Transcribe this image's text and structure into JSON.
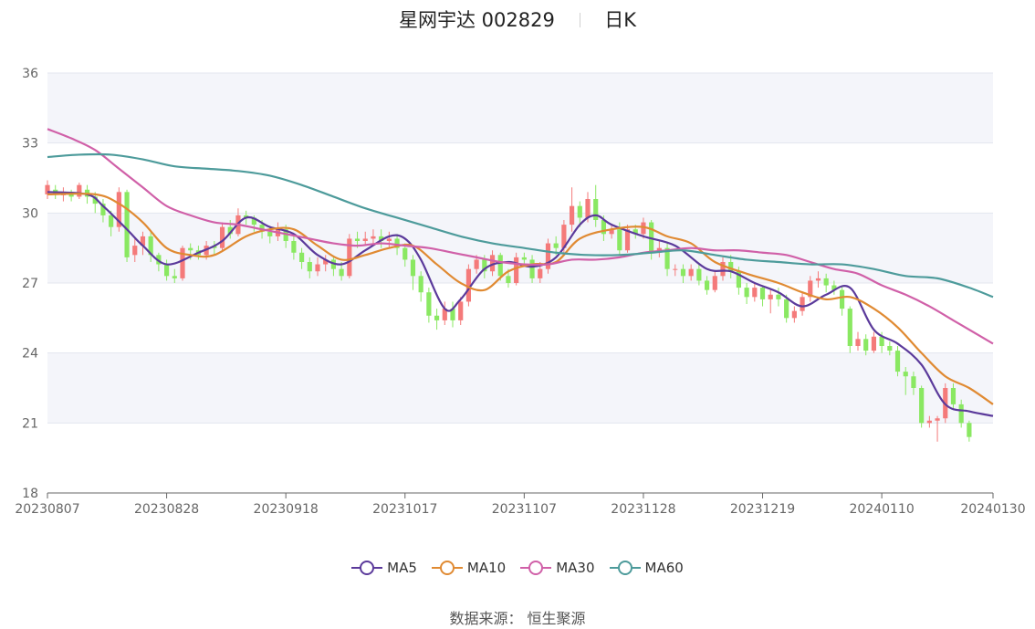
{
  "title": {
    "name": "星网宇达 002829",
    "period": "日K"
  },
  "source": "数据来源： 恒生聚源",
  "chart_data": {
    "type": "candlestick",
    "y_ticks": [
      18,
      21,
      24,
      27,
      30,
      33,
      36
    ],
    "ylim": [
      18,
      36
    ],
    "x_labels": [
      "20230807",
      "20230828",
      "20230918",
      "20231017",
      "20231107",
      "20231128",
      "20231219",
      "20240110",
      "20240130"
    ],
    "x_label_index": [
      0,
      15,
      30,
      45,
      60,
      75,
      90,
      105,
      119
    ],
    "n_days": 120,
    "colors": {
      "up": "#f47a7a",
      "down": "#8ae862",
      "grid_band": "#f4f5fa",
      "grid_line": "#e3e6ef",
      "axis": "#666666"
    },
    "series": [
      {
        "name": "MA5",
        "color": "#5b3a9b",
        "points": [
          [
            0,
            30.9
          ],
          [
            5,
            30.8
          ],
          [
            7,
            30.3
          ],
          [
            10,
            29.3
          ],
          [
            12,
            28.6
          ],
          [
            15,
            27.8
          ],
          [
            19,
            28.3
          ],
          [
            22,
            28.8
          ],
          [
            25,
            29.8
          ],
          [
            28,
            29.4
          ],
          [
            31,
            29.1
          ],
          [
            34,
            28.2
          ],
          [
            37,
            27.8
          ],
          [
            40,
            28.4
          ],
          [
            43,
            29.0
          ],
          [
            45,
            28.9
          ],
          [
            47,
            28.0
          ],
          [
            50,
            25.9
          ],
          [
            52,
            26.3
          ],
          [
            55,
            27.6
          ],
          [
            58,
            27.9
          ],
          [
            61,
            27.7
          ],
          [
            64,
            28.1
          ],
          [
            67,
            29.5
          ],
          [
            69,
            29.9
          ],
          [
            71,
            29.5
          ],
          [
            75,
            29.0
          ],
          [
            79,
            28.6
          ],
          [
            83,
            27.6
          ],
          [
            86,
            27.5
          ],
          [
            89,
            27.0
          ],
          [
            92,
            26.6
          ],
          [
            95,
            26.0
          ],
          [
            98,
            26.5
          ],
          [
            101,
            26.8
          ],
          [
            104,
            25.0
          ],
          [
            107,
            24.4
          ],
          [
            110,
            23.5
          ],
          [
            113,
            21.8
          ],
          [
            116,
            21.5
          ],
          [
            119,
            21.3
          ]
        ]
      },
      {
        "name": "MA10",
        "color": "#e08a32",
        "points": [
          [
            0,
            30.8
          ],
          [
            6,
            30.8
          ],
          [
            9,
            30.4
          ],
          [
            12,
            29.6
          ],
          [
            15,
            28.5
          ],
          [
            18,
            28.2
          ],
          [
            21,
            28.2
          ],
          [
            25,
            29.0
          ],
          [
            28,
            29.3
          ],
          [
            31,
            29.3
          ],
          [
            34,
            28.6
          ],
          [
            37,
            28.0
          ],
          [
            40,
            28.2
          ],
          [
            43,
            28.5
          ],
          [
            46,
            28.6
          ],
          [
            49,
            27.8
          ],
          [
            52,
            27.0
          ],
          [
            55,
            26.7
          ],
          [
            58,
            27.5
          ],
          [
            61,
            27.8
          ],
          [
            64,
            27.9
          ],
          [
            67,
            28.9
          ],
          [
            71,
            29.3
          ],
          [
            75,
            29.4
          ],
          [
            78,
            29.0
          ],
          [
            81,
            28.7
          ],
          [
            84,
            27.9
          ],
          [
            88,
            27.4
          ],
          [
            92,
            27.0
          ],
          [
            95,
            26.6
          ],
          [
            98,
            26.3
          ],
          [
            101,
            26.4
          ],
          [
            104,
            25.9
          ],
          [
            107,
            25.1
          ],
          [
            110,
            24.0
          ],
          [
            113,
            23.0
          ],
          [
            116,
            22.5
          ],
          [
            119,
            21.8
          ]
        ]
      },
      {
        "name": "MA30",
        "color": "#d060a8",
        "points": [
          [
            0,
            33.6
          ],
          [
            3,
            33.2
          ],
          [
            6,
            32.7
          ],
          [
            9,
            31.9
          ],
          [
            12,
            31.1
          ],
          [
            15,
            30.3
          ],
          [
            18,
            29.9
          ],
          [
            21,
            29.6
          ],
          [
            24,
            29.5
          ],
          [
            27,
            29.3
          ],
          [
            30,
            29.1
          ],
          [
            33,
            28.9
          ],
          [
            36,
            28.7
          ],
          [
            39,
            28.6
          ],
          [
            42,
            28.7
          ],
          [
            45,
            28.6
          ],
          [
            48,
            28.5
          ],
          [
            51,
            28.3
          ],
          [
            54,
            28.1
          ],
          [
            57,
            27.9
          ],
          [
            60,
            27.8
          ],
          [
            63,
            27.8
          ],
          [
            66,
            28.0
          ],
          [
            69,
            28.0
          ],
          [
            72,
            28.1
          ],
          [
            75,
            28.3
          ],
          [
            78,
            28.4
          ],
          [
            81,
            28.5
          ],
          [
            84,
            28.4
          ],
          [
            87,
            28.4
          ],
          [
            90,
            28.3
          ],
          [
            93,
            28.2
          ],
          [
            96,
            27.9
          ],
          [
            99,
            27.6
          ],
          [
            102,
            27.4
          ],
          [
            105,
            26.9
          ],
          [
            108,
            26.5
          ],
          [
            111,
            26.0
          ],
          [
            114,
            25.4
          ],
          [
            117,
            24.8
          ],
          [
            119,
            24.4
          ]
        ]
      },
      {
        "name": "MA60",
        "color": "#4d9b9b",
        "points": [
          [
            0,
            32.4
          ],
          [
            4,
            32.5
          ],
          [
            8,
            32.5
          ],
          [
            12,
            32.3
          ],
          [
            16,
            32.0
          ],
          [
            20,
            31.9
          ],
          [
            24,
            31.8
          ],
          [
            28,
            31.6
          ],
          [
            32,
            31.2
          ],
          [
            36,
            30.7
          ],
          [
            40,
            30.2
          ],
          [
            44,
            29.8
          ],
          [
            48,
            29.4
          ],
          [
            52,
            29.0
          ],
          [
            56,
            28.7
          ],
          [
            60,
            28.5
          ],
          [
            64,
            28.3
          ],
          [
            68,
            28.2
          ],
          [
            72,
            28.2
          ],
          [
            76,
            28.3
          ],
          [
            80,
            28.4
          ],
          [
            84,
            28.2
          ],
          [
            88,
            28.0
          ],
          [
            92,
            27.9
          ],
          [
            96,
            27.8
          ],
          [
            100,
            27.8
          ],
          [
            104,
            27.6
          ],
          [
            108,
            27.3
          ],
          [
            112,
            27.2
          ],
          [
            116,
            26.8
          ],
          [
            119,
            26.4
          ]
        ]
      }
    ],
    "candles_ohlc": [
      [
        30.8,
        31.2,
        30.6,
        31.4
      ],
      [
        31.0,
        30.8,
        30.6,
        31.2
      ],
      [
        30.8,
        30.8,
        30.5,
        31.1
      ],
      [
        30.8,
        30.7,
        30.5,
        31.0
      ],
      [
        30.7,
        31.2,
        30.6,
        31.3
      ],
      [
        31.0,
        30.7,
        30.4,
        31.2
      ],
      [
        30.7,
        30.4,
        30.0,
        30.9
      ],
      [
        30.4,
        29.9,
        29.6,
        30.6
      ],
      [
        29.9,
        29.4,
        29.0,
        30.1
      ],
      [
        29.4,
        30.9,
        29.2,
        31.1
      ],
      [
        30.9,
        28.1,
        27.9,
        31.0
      ],
      [
        28.2,
        28.6,
        27.9,
        28.9
      ],
      [
        28.6,
        29.0,
        28.2,
        29.2
      ],
      [
        29.0,
        28.2,
        27.9,
        29.2
      ],
      [
        28.2,
        27.8,
        27.5,
        28.3
      ],
      [
        27.8,
        27.3,
        27.1,
        28.0
      ],
      [
        27.3,
        27.2,
        27.0,
        27.6
      ],
      [
        27.2,
        28.5,
        27.1,
        28.6
      ],
      [
        28.5,
        28.4,
        28.0,
        28.7
      ],
      [
        28.4,
        28.2,
        28.0,
        28.6
      ],
      [
        28.2,
        28.6,
        28.0,
        28.8
      ],
      [
        28.6,
        28.5,
        28.2,
        28.8
      ],
      [
        28.5,
        29.4,
        28.4,
        29.6
      ],
      [
        29.4,
        29.1,
        28.9,
        29.7
      ],
      [
        29.1,
        29.9,
        29.0,
        30.2
      ],
      [
        29.9,
        29.8,
        29.5,
        30.1
      ],
      [
        29.8,
        29.5,
        29.2,
        29.9
      ],
      [
        29.5,
        29.2,
        28.9,
        29.7
      ],
      [
        29.2,
        29.0,
        28.7,
        29.4
      ],
      [
        29.0,
        29.3,
        28.8,
        29.6
      ],
      [
        29.3,
        28.8,
        28.5,
        29.5
      ],
      [
        28.8,
        28.3,
        28.0,
        29.0
      ],
      [
        28.3,
        27.9,
        27.6,
        28.5
      ],
      [
        27.9,
        27.5,
        27.2,
        28.1
      ],
      [
        27.5,
        27.8,
        27.3,
        28.1
      ],
      [
        27.8,
        28.0,
        27.5,
        28.2
      ],
      [
        28.0,
        27.6,
        27.3,
        28.1
      ],
      [
        27.6,
        27.3,
        27.1,
        27.9
      ],
      [
        27.3,
        28.9,
        27.2,
        29.1
      ],
      [
        28.9,
        28.8,
        28.5,
        29.2
      ],
      [
        28.8,
        28.9,
        28.6,
        29.2
      ],
      [
        28.9,
        29.0,
        28.6,
        29.3
      ],
      [
        29.0,
        28.8,
        28.5,
        29.3
      ],
      [
        28.8,
        28.9,
        28.5,
        29.2
      ],
      [
        28.9,
        28.5,
        28.2,
        29.1
      ],
      [
        28.5,
        28.0,
        27.7,
        28.7
      ],
      [
        28.0,
        27.3,
        26.7,
        28.2
      ],
      [
        27.3,
        26.6,
        26.2,
        27.5
      ],
      [
        26.6,
        25.6,
        25.3,
        26.8
      ],
      [
        25.6,
        25.4,
        25.0,
        25.9
      ],
      [
        25.4,
        25.9,
        25.2,
        26.2
      ],
      [
        25.9,
        25.4,
        25.1,
        26.2
      ],
      [
        25.4,
        26.2,
        25.2,
        26.4
      ],
      [
        26.2,
        27.6,
        26.0,
        27.8
      ],
      [
        27.6,
        28.0,
        27.4,
        28.2
      ],
      [
        28.0,
        27.5,
        27.2,
        28.2
      ],
      [
        27.5,
        28.2,
        27.3,
        28.4
      ],
      [
        28.2,
        27.3,
        27.1,
        28.3
      ],
      [
        27.3,
        27.0,
        26.8,
        27.6
      ],
      [
        27.0,
        28.1,
        26.9,
        28.3
      ],
      [
        28.1,
        28.0,
        27.7,
        28.3
      ],
      [
        28.0,
        27.2,
        27.0,
        28.2
      ],
      [
        27.2,
        27.6,
        27.0,
        27.9
      ],
      [
        27.6,
        28.7,
        27.4,
        28.9
      ],
      [
        28.7,
        28.5,
        28.2,
        29.0
      ],
      [
        28.5,
        29.5,
        28.3,
        29.7
      ],
      [
        29.5,
        30.3,
        29.2,
        31.1
      ],
      [
        30.3,
        29.8,
        29.4,
        30.5
      ],
      [
        29.8,
        30.6,
        29.6,
        30.9
      ],
      [
        30.6,
        29.7,
        29.4,
        31.2
      ],
      [
        29.7,
        29.1,
        28.8,
        29.9
      ],
      [
        29.1,
        29.3,
        28.9,
        29.5
      ],
      [
        29.3,
        28.4,
        28.2,
        29.6
      ],
      [
        28.4,
        29.3,
        28.3,
        29.5
      ],
      [
        29.3,
        29.1,
        28.9,
        29.5
      ],
      [
        29.1,
        29.6,
        28.9,
        29.8
      ],
      [
        29.6,
        28.3,
        28.0,
        29.7
      ],
      [
        28.3,
        28.5,
        28.1,
        28.8
      ],
      [
        28.5,
        27.6,
        27.3,
        28.7
      ],
      [
        27.6,
        27.6,
        27.3,
        27.8
      ],
      [
        27.6,
        27.3,
        27.0,
        27.8
      ],
      [
        27.3,
        27.6,
        27.1,
        27.8
      ],
      [
        27.6,
        27.1,
        26.9,
        27.8
      ],
      [
        27.1,
        26.7,
        26.5,
        27.3
      ],
      [
        26.7,
        27.3,
        26.6,
        27.5
      ],
      [
        27.3,
        27.9,
        27.1,
        28.1
      ],
      [
        27.9,
        27.5,
        27.2,
        28.2
      ],
      [
        27.5,
        26.8,
        26.5,
        27.7
      ],
      [
        26.8,
        26.4,
        26.1,
        27.0
      ],
      [
        26.4,
        26.8,
        26.2,
        27.0
      ],
      [
        26.8,
        26.3,
        26.0,
        26.9
      ],
      [
        26.3,
        26.5,
        25.7,
        26.7
      ],
      [
        26.5,
        26.3,
        26.0,
        26.8
      ],
      [
        26.3,
        25.5,
        25.3,
        26.5
      ],
      [
        25.5,
        25.8,
        25.3,
        26.0
      ],
      [
        25.8,
        26.4,
        25.6,
        26.6
      ],
      [
        26.4,
        27.1,
        26.2,
        27.3
      ],
      [
        27.1,
        27.2,
        26.8,
        27.5
      ],
      [
        27.2,
        26.9,
        26.6,
        27.4
      ],
      [
        26.9,
        26.7,
        26.5,
        27.1
      ],
      [
        26.7,
        25.9,
        25.6,
        26.9
      ],
      [
        25.9,
        24.3,
        24.0,
        26.0
      ],
      [
        24.3,
        24.6,
        24.1,
        24.9
      ],
      [
        24.6,
        24.1,
        23.9,
        24.8
      ],
      [
        24.1,
        24.7,
        24.0,
        24.9
      ],
      [
        24.7,
        24.3,
        24.0,
        24.9
      ],
      [
        24.3,
        24.1,
        23.9,
        24.5
      ],
      [
        24.1,
        23.2,
        23.0,
        24.3
      ],
      [
        23.2,
        23.0,
        22.2,
        23.4
      ],
      [
        23.0,
        22.5,
        22.2,
        23.2
      ],
      [
        22.5,
        21.0,
        20.8,
        22.6
      ],
      [
        21.0,
        21.1,
        20.8,
        21.3
      ],
      [
        21.1,
        21.2,
        20.2,
        21.3
      ],
      [
        21.2,
        22.5,
        21.0,
        22.7
      ],
      [
        22.5,
        21.8,
        21.6,
        22.7
      ],
      [
        21.8,
        21.0,
        20.8,
        22.0
      ],
      [
        21.0,
        20.4,
        20.2,
        21.1
      ]
    ]
  }
}
